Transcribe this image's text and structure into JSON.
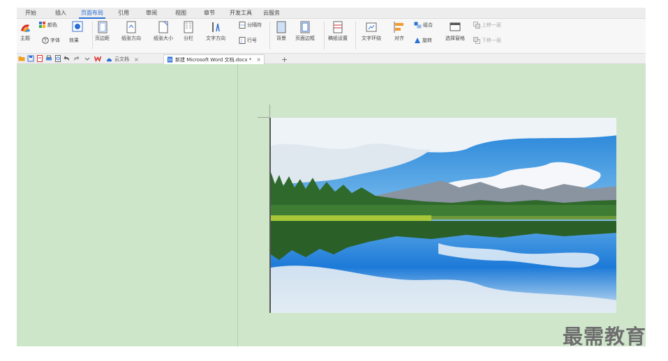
{
  "menu": {
    "tabs": [
      "开始",
      "插入",
      "页面布局",
      "引用",
      "审阅",
      "视图",
      "章节",
      "开发工具",
      "云服务"
    ],
    "active_tab": "页面布局"
  },
  "ribbon": {
    "theme": "主题",
    "colors": "颜色",
    "fonts": "字体",
    "effects": "效果",
    "margins": "页边距",
    "orientation": "纸张方向",
    "paper_size": "纸张大小",
    "columns": "分栏",
    "text_direction": "文字方向",
    "separator": "分隔符",
    "line_numbers": "行号",
    "background": "背景",
    "page_border": "页面边框",
    "manuscript": "稿纸设置",
    "text_wrap": "文字环绕",
    "align": "对齐",
    "group": "组合",
    "rotate": "旋转",
    "selection_pane": "选择窗格",
    "bring_forward": "上移一层",
    "send_backward": "下移一层"
  },
  "tabbar": {
    "cloud_docs": "云文档",
    "active_doc": "新建 Microsoft Word 文档.docx *",
    "close": "×",
    "new_tab": "+"
  },
  "watermark": "最需教育",
  "colors": {
    "accent": "#2b6fd6",
    "workspace_bg": "#cfe6cb",
    "brand_red": "#d9302c"
  }
}
